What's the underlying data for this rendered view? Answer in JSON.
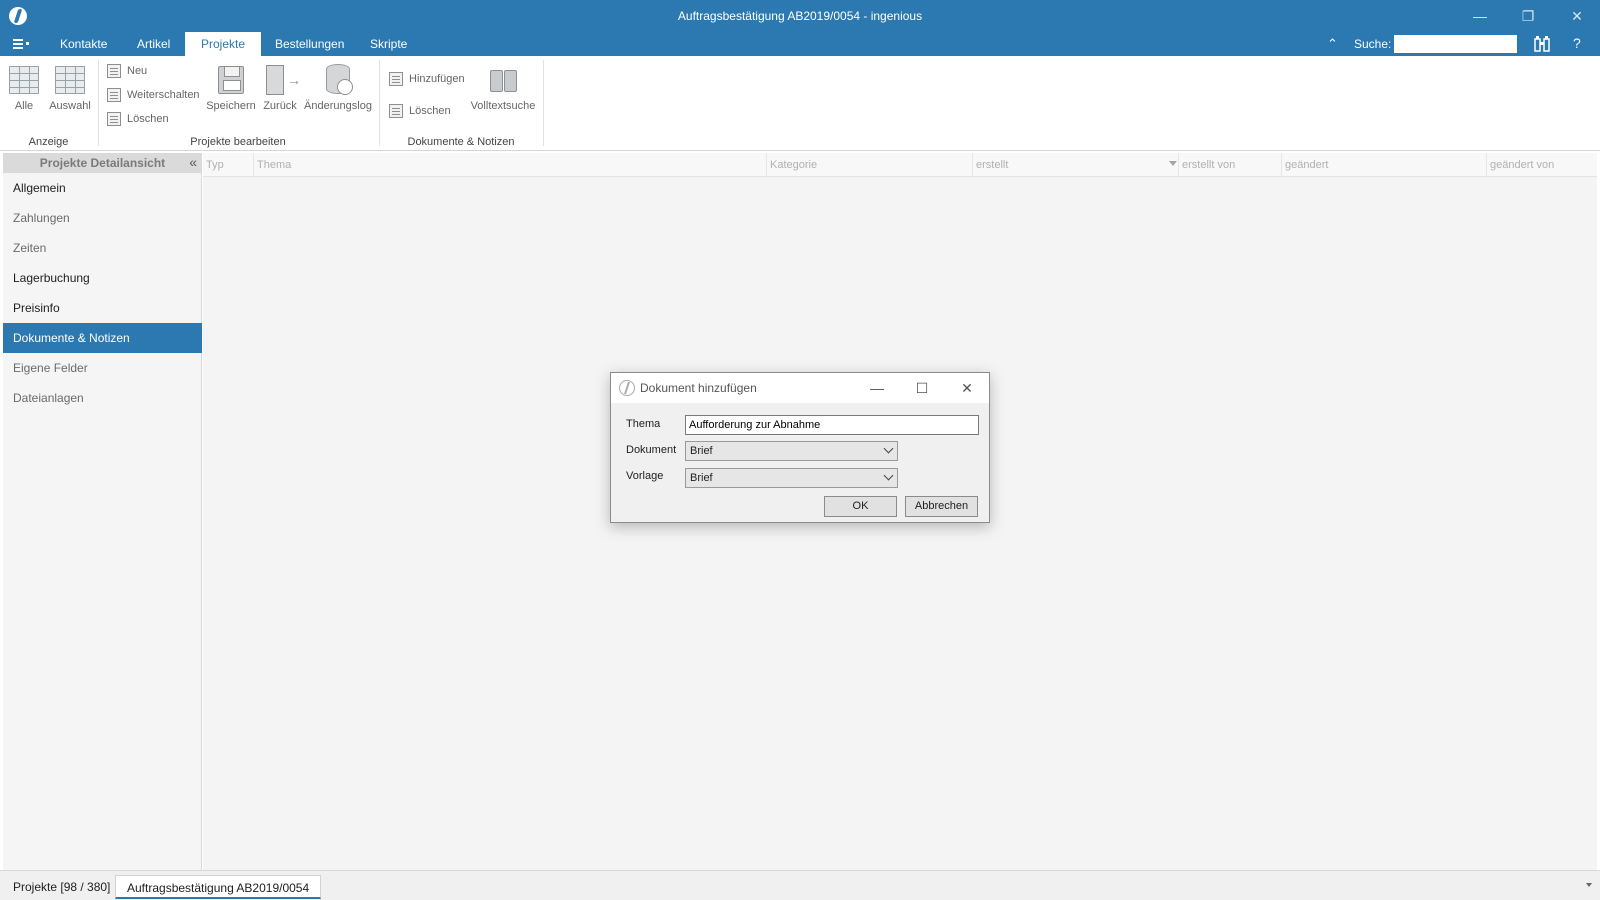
{
  "window": {
    "title": "Auftragsbestätigung AB2019/0054 - ingenious",
    "controls": [
      "minimize-icon",
      "restore-icon",
      "close-icon"
    ]
  },
  "ribbon_tabs": [
    {
      "label": "Kontakte"
    },
    {
      "label": "Artikel"
    },
    {
      "label": "Projekte",
      "active": true
    },
    {
      "label": "Bestellungen"
    },
    {
      "label": "Skripte"
    }
  ],
  "search": {
    "label": "Suche:",
    "value": ""
  },
  "help": "?",
  "ribbon": {
    "groups": {
      "anzeige": "Anzeige",
      "bearbeiten": "Projekte bearbeiten",
      "dokumente": "Dokumente & Notizen"
    },
    "buttons": {
      "alle": "Alle",
      "auswahl": "Auswahl",
      "neu": "Neu",
      "weiterschalten": "Weiterschalten",
      "loeschen": "Löschen",
      "speichern": "Speichern",
      "zurueck": "Zurück",
      "aenderungslog": "Änderungslog",
      "hinzufuegen": "Hinzufügen",
      "loeschen2": "Löschen",
      "volltextsuche": "Volltextsuche"
    }
  },
  "sidebar": {
    "title": "Projekte Detailansicht",
    "items": [
      {
        "label": "Allgemein"
      },
      {
        "label": "Zahlungen"
      },
      {
        "label": "Zeiten"
      },
      {
        "label": "Lagerbuchung"
      },
      {
        "label": "Preisinfo"
      },
      {
        "label": "Dokumente & Notizen",
        "selected": true
      },
      {
        "label": "Eigene Felder"
      },
      {
        "label": "Dateianlagen"
      }
    ]
  },
  "grid": {
    "columns": [
      "Typ",
      "Thema",
      "Kategorie",
      "erstellt",
      "erstellt von",
      "geändert",
      "geändert von"
    ],
    "sorted_column": "erstellt",
    "rows": []
  },
  "bottom_tabs": [
    {
      "label": "Projekte [98 / 380]"
    },
    {
      "label": "Auftragsbestätigung AB2019/0054",
      "active": true
    }
  ],
  "dialog": {
    "title": "Dokument hinzufügen",
    "fields": {
      "thema_label": "Thema",
      "thema_value": "Aufforderung zur Abnahme",
      "dokument_label": "Dokument",
      "dokument_value": "Brief",
      "vorlage_label": "Vorlage",
      "vorlage_value": "Brief"
    },
    "ok_label": "OK",
    "cancel_label": "Abbrechen"
  },
  "colors": {
    "accent": "#2b79b0",
    "ribbon_bg": "#ffffff",
    "sidebar_selected": "#2b79b0"
  }
}
